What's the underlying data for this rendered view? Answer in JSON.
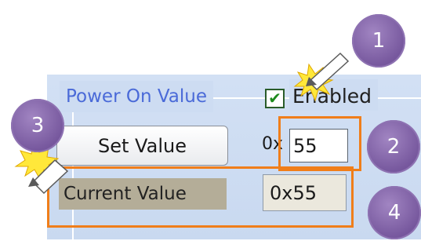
{
  "group": {
    "title": "Power On Value"
  },
  "enabled": {
    "label": "Enabled",
    "checked": true,
    "check_mark": "✔"
  },
  "set_value": {
    "label": "Set Value",
    "prefix": "0x",
    "input_value": "55"
  },
  "current_value": {
    "label": "Current Value",
    "value": "0x55"
  },
  "callouts": [
    "1",
    "2",
    "3",
    "4"
  ],
  "colors": {
    "highlight": "#f07e1a",
    "badge": "#8a6bb0",
    "panel": "#cddcf2",
    "group_title": "#4a6ad8"
  },
  "icons": [
    "checkbox-icon",
    "starburst-pointer-icon"
  ]
}
